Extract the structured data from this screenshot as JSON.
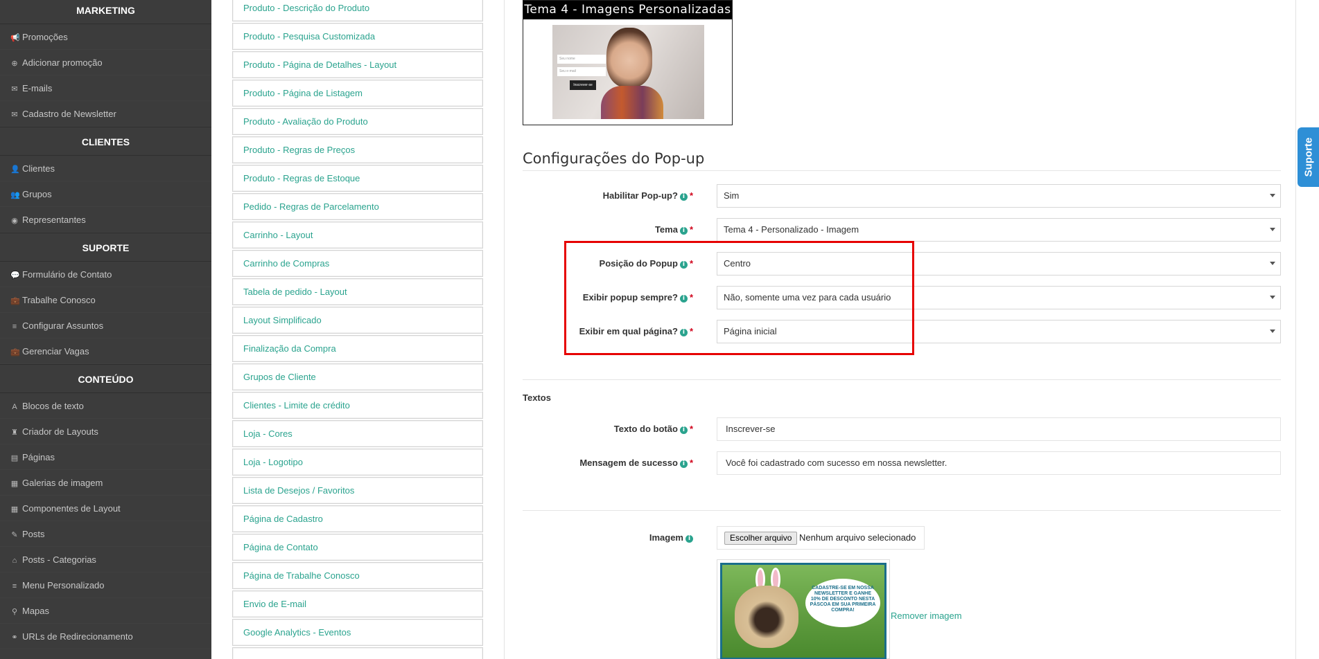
{
  "sidebar": {
    "sections": [
      {
        "title": "MARKETING",
        "items": [
          {
            "label": "Promoções",
            "icon": "bullhorn-icon",
            "glyph": "📢"
          },
          {
            "label": "Adicionar promoção",
            "icon": "plus-circle-icon",
            "glyph": "⊕"
          },
          {
            "label": "E-mails",
            "icon": "envelope-icon",
            "glyph": "✉"
          },
          {
            "label": "Cadastro de Newsletter",
            "icon": "envelope-icon",
            "glyph": "✉"
          }
        ]
      },
      {
        "title": "CLIENTES",
        "items": [
          {
            "label": "Clientes",
            "icon": "user-icon",
            "glyph": "👤"
          },
          {
            "label": "Grupos",
            "icon": "users-icon",
            "glyph": "👥"
          },
          {
            "label": "Representantes",
            "icon": "user-circle-icon",
            "glyph": "◉"
          }
        ]
      },
      {
        "title": "SUPORTE",
        "items": [
          {
            "label": "Formulário de Contato",
            "icon": "comment-icon",
            "glyph": "💬"
          },
          {
            "label": "Trabalhe Conosco",
            "icon": "briefcase-icon",
            "glyph": "💼"
          },
          {
            "label": "Configurar Assuntos",
            "icon": "list-icon",
            "glyph": "≡"
          },
          {
            "label": "Gerenciar Vagas",
            "icon": "briefcase-icon",
            "glyph": "💼"
          }
        ]
      },
      {
        "title": "CONTEÚDO",
        "items": [
          {
            "label": "Blocos de texto",
            "icon": "font-icon",
            "glyph": "A"
          },
          {
            "label": "Criador de Layouts",
            "icon": "chess-rook-icon",
            "glyph": "♜"
          },
          {
            "label": "Páginas",
            "icon": "file-icon",
            "glyph": "▤"
          },
          {
            "label": "Galerias de imagem",
            "icon": "film-icon",
            "glyph": "▦"
          },
          {
            "label": "Componentes de Layout",
            "icon": "th-large-icon",
            "glyph": "▦"
          },
          {
            "label": "Posts",
            "icon": "thumbtack-icon",
            "glyph": "✎"
          },
          {
            "label": "Posts - Categorias",
            "icon": "home-icon",
            "glyph": "⌂"
          },
          {
            "label": "Menu Personalizado",
            "icon": "list-icon",
            "glyph": "≡"
          },
          {
            "label": "Mapas",
            "icon": "map-marker-icon",
            "glyph": "⚲"
          },
          {
            "label": "URLs de Redirecionamento",
            "icon": "link-icon",
            "glyph": "⚭"
          }
        ]
      }
    ]
  },
  "menu_list": [
    "Produto - Descrição do Produto",
    "Produto - Pesquisa Customizada",
    "Produto - Página de Detalhes - Layout",
    "Produto - Página de Listagem",
    "Produto - Avaliação do Produto",
    "Produto - Regras de Preços",
    "Produto - Regras de Estoque",
    "Pedido - Regras de Parcelamento",
    "Carrinho - Layout",
    "Carrinho de Compras",
    "Tabela de pedido - Layout",
    "Layout Simplificado",
    "Finalização da Compra",
    "Grupos de Cliente",
    "Clientes - Limite de crédito",
    "Loja - Cores",
    "Loja - Logotipo",
    "Lista de Desejos / Favoritos",
    "Página de Cadastro",
    "Página de Contato",
    "Página de Trabalhe Conosco",
    "Envio de E-mail",
    "Google Analytics - Eventos"
  ],
  "theme_preview": {
    "title": "Tema 4 - Imagens Personalizadas",
    "name_placeholder": "Seu nome",
    "email_placeholder": "Seu e-mail",
    "button": "Inscrever-se"
  },
  "popup_config": {
    "title": "Configurações do Pop-up",
    "fields": [
      {
        "label": "Habilitar Pop-up?",
        "value": "Sim"
      },
      {
        "label": "Tema",
        "value": "Tema 4 - Personalizado - Imagem"
      },
      {
        "label": "Posição do Popup",
        "value": "Centro"
      },
      {
        "label": "Exibir popup sempre?",
        "value": "Não, somente uma vez para cada usuário"
      },
      {
        "label": "Exibir em qual página?",
        "value": "Página inicial"
      }
    ]
  },
  "texts": {
    "title": "Textos",
    "button_text_label": "Texto do botão",
    "button_text_value": "Inscrever-se",
    "success_label": "Mensagem de sucesso",
    "success_value": "Você foi cadastrado com sucesso em nossa newsletter."
  },
  "image": {
    "label": "Imagem",
    "choose_button": "Escolher arquivo",
    "no_file": "Nenhum arquivo selecionado",
    "remove_link": "Remover imagem",
    "promo_text": "CADASTRE-SE EM NOSSA NEWSLETTER E GANHE 10% DE DESCONTO NESTA PÁSCOA EM SUA PRIMEIRA COMPRA!"
  },
  "support_tab": "Suporte",
  "colors": {
    "accent": "#2aa38e",
    "sidebar_bg": "#3c3c3c",
    "highlight": "#e60000",
    "support": "#2e8fd6"
  }
}
